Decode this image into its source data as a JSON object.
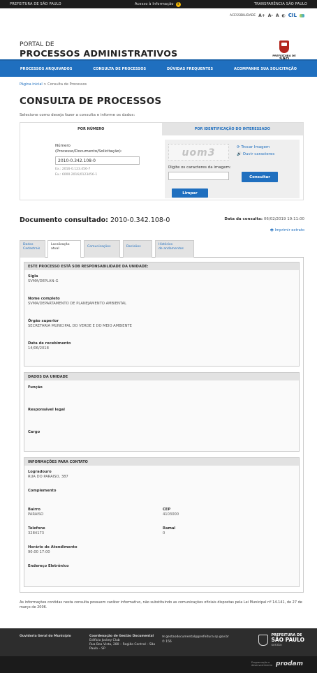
{
  "topbar": {
    "left": "PREFEITURA DE SÃO PAULO",
    "center": "Acesso à Informação",
    "right": "TRANSPARÊNCIA SÃO PAULO"
  },
  "accessibility": {
    "label": "ACESSIBILIDADE",
    "a_plus": "A+",
    "a_minus": "A-",
    "a": "A",
    "contrast": "◐",
    "cil": "CIL"
  },
  "portal": {
    "small": "PORTAL DE",
    "big": "PROCESSOS ADMINISTRATIVOS"
  },
  "logo": {
    "line1": "PREFEITURA DE",
    "line2": "SÃO PAULO"
  },
  "nav": [
    "PROCESSOS ARQUIVADOS",
    "CONSULTA DE PROCESSOS",
    "DÚVIDAS FREQUENTES",
    "ACOMPANHE SUA SOLICITAÇÃO"
  ],
  "breadcrumb": {
    "home": "Página inicial",
    "sep": ">",
    "current": "Consulta de Processos"
  },
  "page": {
    "title": "CONSULTA DE PROCESSOS",
    "subtitle": "Selecione como deseja fazer a consulta e informe os dados:"
  },
  "search_tabs": {
    "by_number": "POR NÚMERO",
    "by_person": "POR IDENTIFICAÇÃO DO INTERESSADO"
  },
  "form": {
    "number_label1": "Número",
    "number_label2": "(Processo/Documento/Solicitação):",
    "number_value": "2010-0.342.108-0",
    "example1": "Ex.: 2016-0.123.456-7",
    "example2": "Ex.: 6000.2016/0123456-1",
    "captcha_text": "uom3",
    "change_image": "Trocar Imagem",
    "listen": "Ouvir caracteres",
    "captcha_label": "Digite os caracteres da imagem:",
    "consult_button": "Consultar",
    "clear_button": "Limpar"
  },
  "document": {
    "label": "Documento consultado:",
    "number": "2010-0.342.108-0",
    "date_label": "Data da consulta:",
    "date_value": "06/02/2019 19:11:00",
    "print": "Imprimir extrato"
  },
  "tabs": [
    {
      "l1": "Dados",
      "l2": "Cadastrais"
    },
    {
      "l1": "Localização",
      "l2": "atual"
    },
    {
      "l1": "Comunicações",
      "l2": ""
    },
    {
      "l1": "Decisões",
      "l2": ""
    },
    {
      "l1": "Histórico",
      "l2": "de andamentos"
    }
  ],
  "section1": {
    "header": "ESTE PROCESSO ESTÁ SOB RESPONSABILIDADE DA UNIDADE:",
    "sigla_k": "Sigla",
    "sigla_v": "SVMA/DEPLAN-G",
    "nome_k": "Nome completo",
    "nome_v": "SVMA/DEPARTAMENTO DE PLANEJAMENTO AMBIENTAL",
    "orgao_k": "Órgão superior",
    "orgao_v": "SECRETARIA MUNICIPAL DO VERDE E DO MEIO AMBIENTE",
    "data_k": "Data de recebimento",
    "data_v": "14/06/2018"
  },
  "section2": {
    "header": "DADOS DA UNIDADE",
    "funcao": "Função",
    "responsavel": "Responsável legal",
    "cargo": "Cargo"
  },
  "section3": {
    "header": "INFORMAÇÕES PARA CONTATO",
    "log_k": "Logradouro",
    "log_v": "RUA DO PARAISO, 387",
    "comp_k": "Complemento",
    "bairro_k": "Bairro",
    "bairro_v": "PARAISO",
    "cep_k": "CEP",
    "cep_v": "4103000",
    "tel_k": "Telefone",
    "tel_v": "3284173",
    "ramal_k": "Ramal",
    "ramal_v": "0",
    "hor_k": "Horário de Atendimento",
    "hor_v": "90:00 17:00",
    "email_k": "Endereço Eletrônico"
  },
  "footnote": "As informações contidas nesta consulta possuem caráter informativo, não substituindo as comunicações oficiais dispostas pela Lei Municipal nº 14.141, de 27 de março de 2006.",
  "footer": {
    "ouvidoria": "Ouvidoria Geral do Município",
    "coord_title": "Coordenação de Gestão Documental",
    "coord_l1": "Edifício Jockey Club",
    "coord_l2": "Rua Boa Vista, 280 – Região Central – São",
    "coord_l3": "Paulo – SP",
    "email": "gestaodocumental@prefeitura.sp.gov.br",
    "phone": "156",
    "logo1": "PREFEITURA DE",
    "logo2": "SÃO PAULO",
    "logo3": "GESTÃO"
  },
  "bottom": {
    "dev1": "Programação e",
    "dev2": "desenvolvimento",
    "brand": "prodam"
  }
}
